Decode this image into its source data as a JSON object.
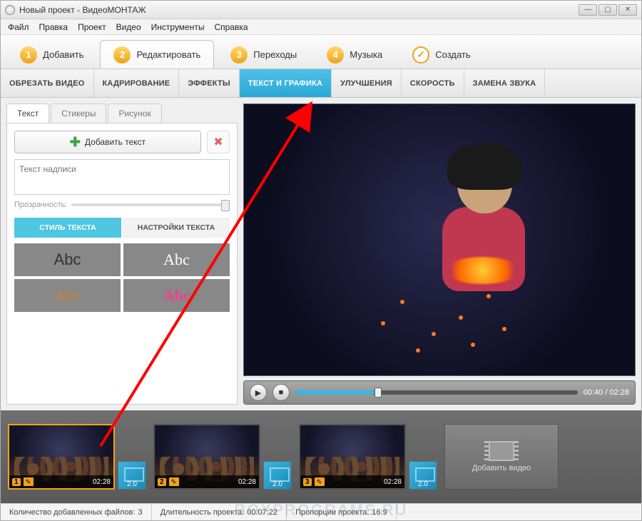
{
  "window": {
    "title": "Новый проект - ВидеоМОНТАЖ"
  },
  "menubar": [
    "Файл",
    "Правка",
    "Проект",
    "Видео",
    "Инструменты",
    "Справка"
  ],
  "maintabs": [
    {
      "num": "1",
      "label": "Добавить"
    },
    {
      "num": "2",
      "label": "Редактировать",
      "active": true
    },
    {
      "num": "3",
      "label": "Переходы"
    },
    {
      "num": "4",
      "label": "Музыка"
    },
    {
      "check": true,
      "label": "Создать"
    }
  ],
  "toolbar": [
    {
      "label": "ОБРЕЗАТЬ ВИДЕО"
    },
    {
      "label": "КАДРИРОВАНИЕ"
    },
    {
      "label": "ЭФФЕКТЫ"
    },
    {
      "label": "ТЕКСТ И ГРАФИКА",
      "active": true
    },
    {
      "label": "УЛУЧШЕНИЯ"
    },
    {
      "label": "СКОРОСТЬ"
    },
    {
      "label": "ЗАМЕНА ЗВУКА"
    }
  ],
  "subtabs": [
    {
      "label": "Текст",
      "active": true
    },
    {
      "label": "Стикеры"
    },
    {
      "label": "Рисунок"
    }
  ],
  "textpanel": {
    "add_label": "Добавить текст",
    "placeholder": "Текст надписи",
    "opacity_label": "Прозрачность:"
  },
  "styletabs": [
    {
      "label": "СТИЛЬ ТЕКСТА",
      "active": true
    },
    {
      "label": "НАСТРОЙКИ ТЕКСТА"
    }
  ],
  "styles_sample": "Abc",
  "player": {
    "time": "00:40 / 02:28"
  },
  "clips": [
    {
      "num": "1",
      "dur": "02:28",
      "selected": true
    },
    {
      "num": "2",
      "dur": "02:28"
    },
    {
      "num": "3",
      "dur": "02:28"
    }
  ],
  "transition_duration": "2.0",
  "add_video_label": "Добавить видео",
  "status": {
    "files_label": "Количество добавленных файлов:",
    "files_value": "3",
    "duration_label": "Длительность проекта:",
    "duration_value": "00:07:22",
    "aspect_label": "Пропорции проекта:",
    "aspect_value": "16:9"
  },
  "watermark": "BoxPrograms.ru"
}
